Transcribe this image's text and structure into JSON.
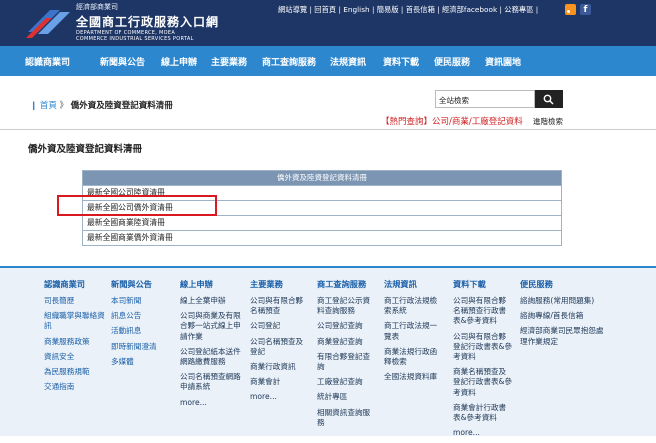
{
  "header": {
    "ministry": "經濟部商業司",
    "portal_title": "全國商工行政服務入口網",
    "english1": "DEPARTMENT OF COMMERCE, MOEA",
    "english2": "COMMERCE INDUSTRIAL SERVICES PORTAL",
    "toplinks": "網站導覽 | 回首頁 | English | 簡易版 | 首長信箱 | 經濟部facebook | 公務專區 |"
  },
  "nav": [
    "認識商業司",
    "新聞與公告",
    "線上申辦",
    "主要業務",
    "商工查詢服務",
    "法規資訊",
    "資料下載",
    "便民服務",
    "資訊園地"
  ],
  "breadcrumb": {
    "home": "首頁",
    "sep": "》",
    "current": "僑外資及陸資登記資料清冊"
  },
  "search": {
    "value": "全站檢索"
  },
  "hot_query": "【熱門查詢】公司/商業/工廠登記資料",
  "advanced_search": "進階檢索",
  "page_title": "僑外資及陸資登記資料清冊",
  "table": {
    "header": "僑外資及陸資登記資料清冊",
    "rows": [
      "最新全國公司陸資清冊",
      "最新全國公司僑外資清冊",
      "最新全國商業陸資清冊",
      "最新全國商業僑外資清冊"
    ]
  },
  "footer": [
    {
      "title": "認識商業司",
      "links": [
        "司長簡歷",
        "組織職掌與聯絡資訊",
        "商業服務政策",
        "資訊安全",
        "為民服務規範",
        "交通指南"
      ]
    },
    {
      "title": "新聞與公告",
      "links": [
        "本司新聞",
        "訊息公告",
        "活動訊息",
        "即時新聞澄清",
        "多媒體"
      ]
    },
    {
      "title": "線上申辦",
      "links": [
        "線上全葉申辦",
        "公司與商業及有限合夥一站式線上申請作業",
        "公司登記紙本送件網路繳費服務",
        "公司名稱預查網路申請系統",
        "more..."
      ]
    },
    {
      "title": "主要業務",
      "links": [
        "公司與有限合夥名稱預查",
        "公司登記",
        "公司名稱預查及登記",
        "商業行政資訊",
        "商業會計",
        "more..."
      ]
    },
    {
      "title": "商工查詢服務",
      "links": [
        "商工登記公示資料查詢服務",
        "公司登記查詢",
        "商業登記查詢",
        "有限合夥登記查詢",
        "工廠登記查詢",
        "統計專區",
        "相關資訊查詢服務"
      ]
    },
    {
      "title": "法規資訊",
      "links": [
        "商工行政法規檢索系統",
        "商工行政法規一覽表",
        "商業法規行政函釋檢索",
        "全國法規資料庫"
      ]
    },
    {
      "title": "資料下載",
      "links": [
        "公司與有限合夥名稱預查行政書表&參考資料",
        "公司與有限合夥登記行政書表&參考資料",
        "商業名稱預查及登記行政書表&參考資料",
        "商業會計行政書表&參考資料",
        "more..."
      ]
    },
    {
      "title": "便民服務",
      "links": [
        "諮詢服務(常用問題集)",
        "諮詢專線/首長信箱",
        "經濟部商業司民眾抱怨處理作業規定"
      ]
    }
  ],
  "colors": {
    "header_bg": "#1e3666",
    "nav_bg": "#2d87cf",
    "highlight": "#d9181f",
    "hot_red": "#d02020"
  }
}
